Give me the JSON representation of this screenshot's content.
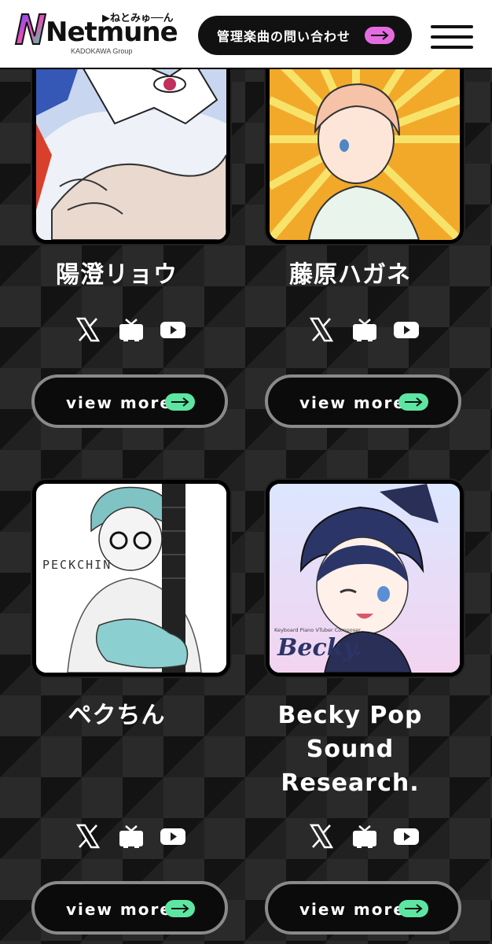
{
  "header": {
    "logo_word": "Netmune",
    "logo_kana": "▶ねとみゅ──ん",
    "logo_group": "KADOKAWA Group",
    "contact_label": "管理楽曲の問い合わせ",
    "accent_pink": "#e46ce0",
    "accent_green": "#5de6a2"
  },
  "artists": [
    {
      "name": "陽澄リョウ",
      "view_more": "view more",
      "socials": [
        "x-icon",
        "niconico-icon",
        "youtube-icon"
      ]
    },
    {
      "name": "藤原ハガネ",
      "view_more": "view more",
      "socials": [
        "x-icon",
        "niconico-icon",
        "youtube-icon"
      ]
    },
    {
      "name": "ペクちん",
      "art_text": "PECKCHIN",
      "view_more": "view more",
      "socials": [
        "x-icon",
        "niconico-icon",
        "youtube-icon"
      ]
    },
    {
      "name_lines": [
        "Becky Pop",
        "Sound",
        "Research."
      ],
      "art_text": "Becky.",
      "art_subtext": "Keyboard Piano VTuber Composer",
      "view_more": "view more",
      "socials": [
        "x-icon",
        "niconico-icon",
        "youtube-icon"
      ]
    }
  ]
}
